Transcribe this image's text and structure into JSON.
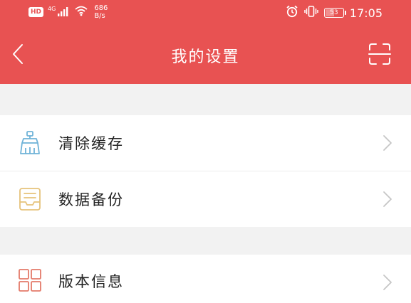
{
  "status_bar": {
    "hd": "HD",
    "network": "4G",
    "speed_value": "686",
    "speed_unit": "B/s",
    "battery": "53",
    "time": "17:05",
    "icons": [
      "signal-icon",
      "wifi-icon",
      "alarm-icon",
      "vibrate-icon",
      "battery-icon"
    ]
  },
  "header": {
    "title": "我的设置",
    "background_color": "#e85252",
    "back_icon": "chevron-left-icon",
    "scan_icon": "scan-icon"
  },
  "settings": {
    "items": [
      {
        "label": "清除缓存",
        "icon": "broom-icon",
        "icon_color": "#6fb3d8"
      },
      {
        "label": "数据备份",
        "icon": "inbox-icon",
        "icon_color": "#e6c27a"
      },
      {
        "label": "版本信息",
        "icon": "grid-icon",
        "icon_color": "#e47a6a"
      }
    ]
  }
}
